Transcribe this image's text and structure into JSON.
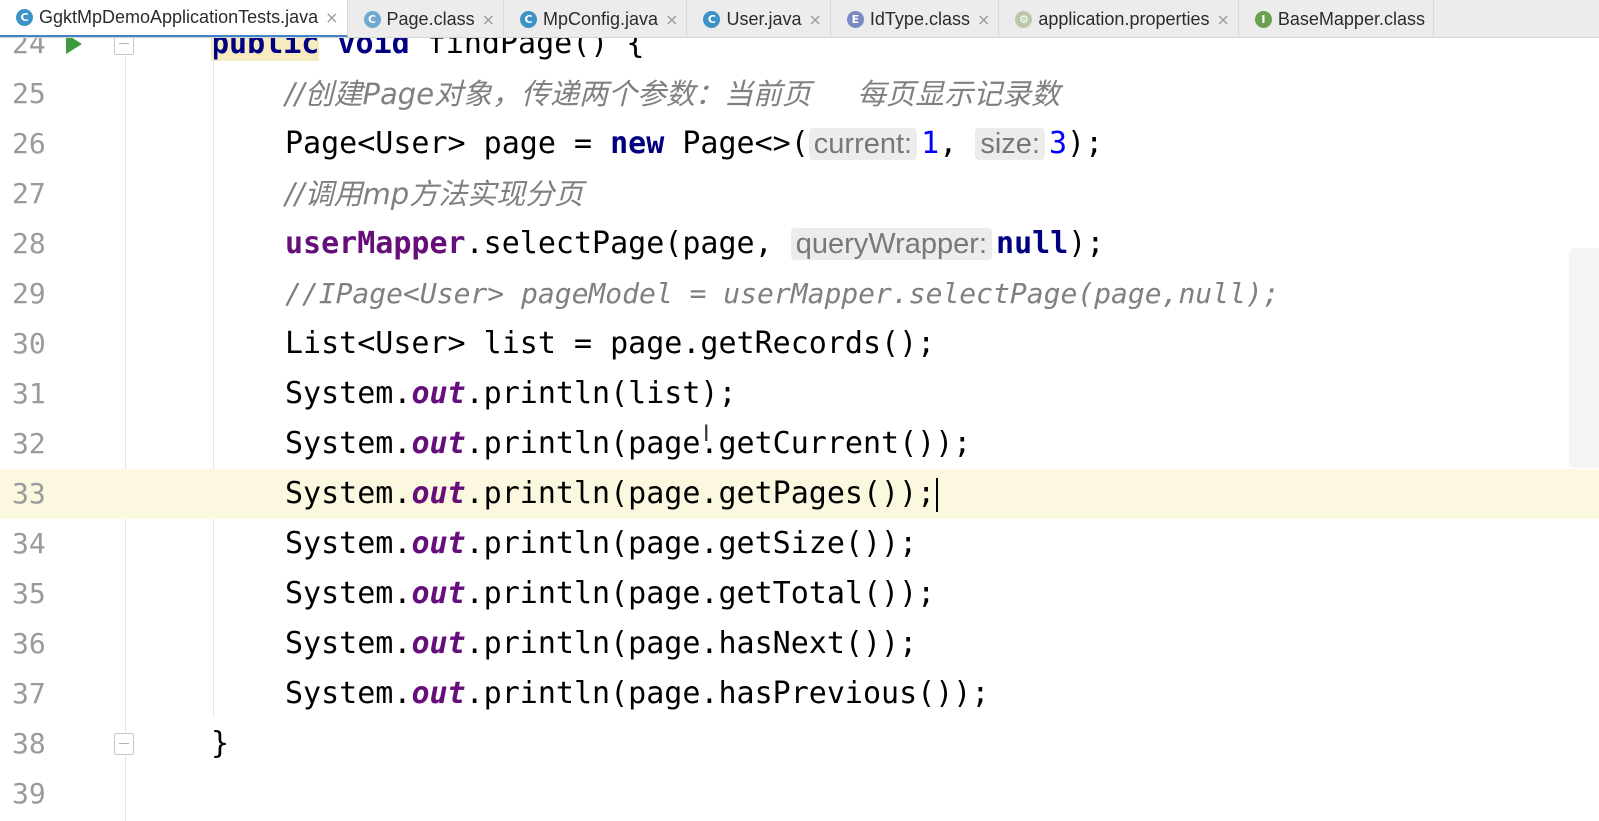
{
  "tabs": [
    {
      "label": "GgktMpDemoApplicationTests.java",
      "icon": "class-icon",
      "active": true,
      "closable": true
    },
    {
      "label": "Page.class",
      "icon": "class-icon",
      "active": false,
      "closable": true
    },
    {
      "label": "MpConfig.java",
      "icon": "class-icon",
      "active": false,
      "closable": true
    },
    {
      "label": "User.java",
      "icon": "class-icon",
      "active": false,
      "closable": true
    },
    {
      "label": "IdType.class",
      "icon": "enum-icon",
      "active": false,
      "closable": true
    },
    {
      "label": "application.properties",
      "icon": "properties-icon",
      "active": false,
      "closable": true
    },
    {
      "label": "BaseMapper.class",
      "icon": "interface-icon",
      "active": false,
      "closable": false
    }
  ],
  "tab_icon_letters": {
    "class": "C",
    "enum": "E",
    "interface": "I",
    "props": "⚙"
  },
  "close_glyph": "×",
  "editor": {
    "current_line": "33",
    "lines": [
      {
        "num": "24",
        "parts": [
          "public",
          " ",
          "void",
          " findPage() {"
        ]
      },
      {
        "num": "25",
        "comment": "//创建Page对象，传递两个参数：当前页     每页显示记录数"
      },
      {
        "num": "26",
        "parts": [
          "Page<User> page = ",
          "new",
          " Page<>(",
          "current:",
          "1",
          ", ",
          "size:",
          "3",
          ");"
        ]
      },
      {
        "num": "27",
        "comment": "//调用mp方法实现分页"
      },
      {
        "num": "28",
        "parts": [
          "userMapper",
          ".selectPage(page, ",
          "queryWrapper:",
          "null",
          ");"
        ]
      },
      {
        "num": "29",
        "comment": "//IPage<User> pageModel = userMapper.selectPage(page,null);"
      },
      {
        "num": "30",
        "text": "List<User> list = page.getRecords();"
      },
      {
        "num": "31",
        "parts": [
          "System.",
          "out",
          ".println(list);"
        ]
      },
      {
        "num": "32",
        "parts": [
          "System.",
          "out",
          ".println(page.getCurrent());"
        ]
      },
      {
        "num": "33",
        "parts": [
          "System.",
          "out",
          ".println(page.getPages());"
        ]
      },
      {
        "num": "34",
        "parts": [
          "System.",
          "out",
          ".println(page.getSize());"
        ]
      },
      {
        "num": "35",
        "parts": [
          "System.",
          "out",
          ".println(page.getTotal());"
        ]
      },
      {
        "num": "36",
        "parts": [
          "System.",
          "out",
          ".println(page.hasNext());"
        ]
      },
      {
        "num": "37",
        "parts": [
          "System.",
          "out",
          ".println(page.hasPrevious());"
        ]
      },
      {
        "num": "38",
        "text": "}"
      },
      {
        "num": "39",
        "text": ""
      }
    ]
  },
  "colors": {
    "keyword": "#000080",
    "field": "#660e7a",
    "number": "#0000ff",
    "comment": "#808080",
    "current_line": "#fcf8e0",
    "tab_accent": "#4083c9"
  }
}
